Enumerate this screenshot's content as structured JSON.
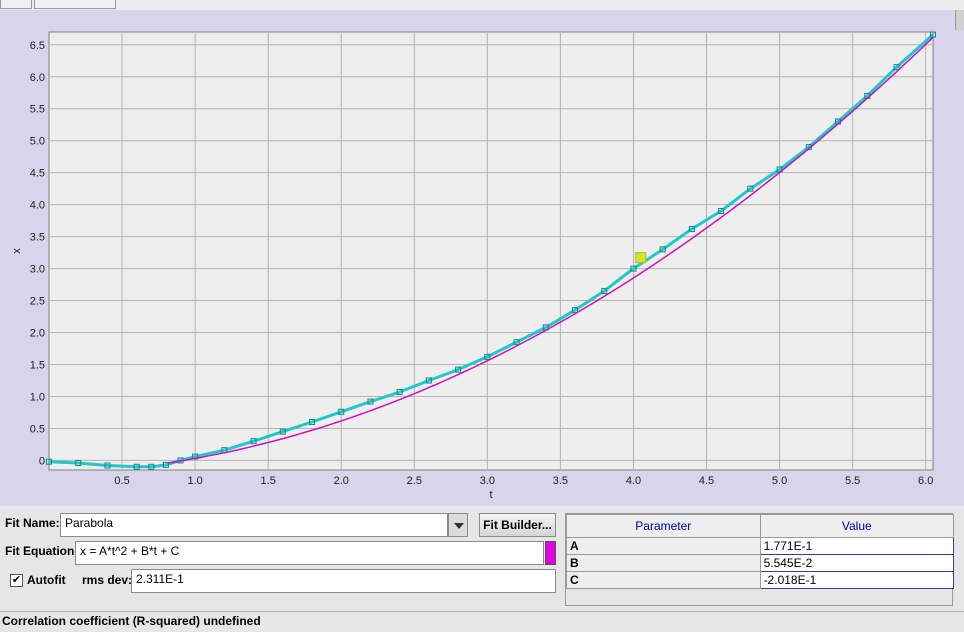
{
  "chart_data": {
    "type": "line",
    "xlabel": "t",
    "ylabel": "x",
    "xlim": [
      0.0,
      6.05
    ],
    "ylim": [
      -0.15,
      6.7
    ],
    "xticks": [
      "0.5",
      "1.0",
      "1.5",
      "2.0",
      "2.5",
      "3.0",
      "3.5",
      "4.0",
      "4.5",
      "5.0",
      "5.5",
      "6.0"
    ],
    "yticks": [
      "0",
      "0.5",
      "1.0",
      "1.5",
      "2.0",
      "2.5",
      "3.0",
      "3.5",
      "4.0",
      "4.5",
      "5.0",
      "5.5",
      "6.0",
      "6.5"
    ],
    "grid": true,
    "series": [
      {
        "kind": "data",
        "color": "#20c8c8",
        "x": [
          0.0,
          0.2,
          0.4,
          0.6,
          0.7,
          0.8,
          0.9,
          1.0,
          1.2,
          1.4,
          1.6,
          1.8,
          2.0,
          2.2,
          2.4,
          2.6,
          2.8,
          3.0,
          3.2,
          3.4,
          3.6,
          3.8,
          4.0,
          4.2,
          4.4,
          4.6,
          4.8,
          5.0,
          5.2,
          5.4,
          5.6,
          5.8,
          6.05
        ],
        "y": [
          -0.02,
          -0.04,
          -0.08,
          -0.1,
          -0.1,
          -0.07,
          0.0,
          0.06,
          0.16,
          0.3,
          0.45,
          0.6,
          0.76,
          0.92,
          1.07,
          1.25,
          1.42,
          1.62,
          1.85,
          2.08,
          2.35,
          2.65,
          3.0,
          3.3,
          3.62,
          3.9,
          4.25,
          4.55,
          4.9,
          5.3,
          5.7,
          6.15,
          6.66
        ]
      },
      {
        "kind": "fit",
        "color": "#d010c0",
        "fit": {
          "A": 0.1771,
          "B": 0.05545,
          "C": -0.2018
        },
        "xrange": [
          0.82,
          6.05
        ]
      }
    ],
    "highlight_point": {
      "x": 4.05,
      "y": 3.17,
      "color": "#d6e626"
    }
  },
  "fit_panel": {
    "fit_name_label": "Fit Name:",
    "fit_name_value": "Parabola",
    "fit_builder_label": "Fit Builder...",
    "fit_equation_label": "Fit Equation:",
    "fit_equation_value": "x = A*t^2 + B*t + C",
    "fit_color": "#e000e0",
    "autofit_checked": true,
    "autofit_label": "Autofit",
    "rms_label": "rms dev:",
    "rms_value": "2.311E-1"
  },
  "param_table": {
    "headers": [
      "Parameter",
      "Value"
    ],
    "rows": [
      {
        "name": "A",
        "value": "1.771E-1"
      },
      {
        "name": "B",
        "value": "5.545E-2"
      },
      {
        "name": "C",
        "value": "-2.018E-1"
      }
    ]
  },
  "status": {
    "text": "Correlation coefficient (R-squared) undefined"
  }
}
